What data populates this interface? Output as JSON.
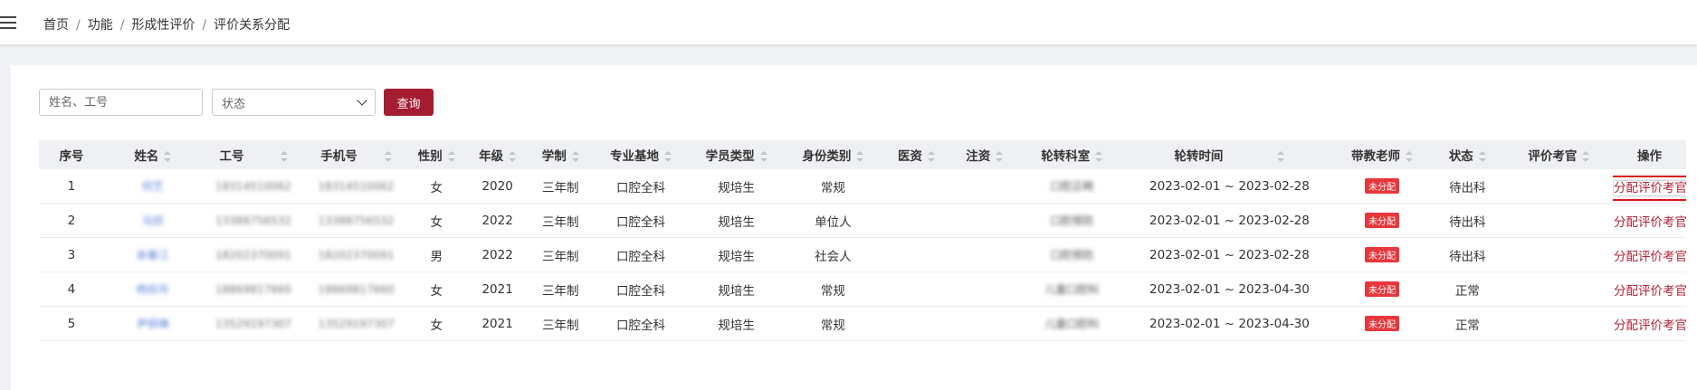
{
  "breadcrumb": [
    "首页",
    "功能",
    "形成性评价",
    "评价关系分配"
  ],
  "search": {
    "placeholder": "姓名、工号",
    "status_placeholder": "状态",
    "query_label": "查询"
  },
  "table": {
    "columns": [
      "序号",
      "姓名",
      "工号",
      "手机号",
      "性别",
      "年级",
      "学制",
      "专业基地",
      "学员类型",
      "身份类别",
      "医资",
      "注资",
      "轮转科室",
      "轮转时间",
      "带教老师",
      "状态",
      "评价考官",
      "操作"
    ],
    "rows": [
      {
        "no": "1",
        "name": "何艺",
        "id": "18314510062",
        "phone": "18314510062",
        "gender": "女",
        "grade": "2020",
        "system": "三年制",
        "base": "口腔全科",
        "type": "规培生",
        "identity": "常规",
        "dept": "口腔正畸",
        "time": "2023-02-01 ~ 2023-02-28",
        "teacher": "未分配",
        "status": "待出科",
        "action": "分配评价考官"
      },
      {
        "no": "2",
        "name": "马欣",
        "id": "13388756532",
        "phone": "13388756532",
        "gender": "女",
        "grade": "2022",
        "system": "三年制",
        "base": "口腔全科",
        "type": "规培生",
        "identity": "单位人",
        "dept": "口腔预防",
        "time": "2023-02-01 ~ 2023-02-28",
        "teacher": "未分配",
        "status": "待出科",
        "action": "分配评价考官"
      },
      {
        "no": "3",
        "name": "余春江",
        "id": "18202370091",
        "phone": "18202370091",
        "gender": "男",
        "grade": "2022",
        "system": "三年制",
        "base": "口腔全科",
        "type": "规培生",
        "identity": "社会人",
        "dept": "口腔预防",
        "time": "2023-02-01 ~ 2023-02-28",
        "teacher": "未分配",
        "status": "待出科",
        "action": "分配评价考官"
      },
      {
        "no": "4",
        "name": "杨玖玲",
        "id": "18869817660",
        "phone": "18869817660",
        "gender": "女",
        "grade": "2021",
        "system": "三年制",
        "base": "口腔全科",
        "type": "规培生",
        "identity": "常规",
        "dept": "儿童口腔科",
        "time": "2023-02-01 ~ 2023-04-30",
        "teacher": "未分配",
        "status": "正常",
        "action": "分配评价考官"
      },
      {
        "no": "5",
        "name": "尹锐琳",
        "id": "13529197307",
        "phone": "13529197307",
        "gender": "女",
        "grade": "2021",
        "system": "三年制",
        "base": "口腔全科",
        "type": "规培生",
        "identity": "常规",
        "dept": "儿童口腔科",
        "time": "2023-02-01 ~ 2023-04-30",
        "teacher": "未分配",
        "status": "正常",
        "action": "分配评价考官"
      }
    ]
  },
  "colors": {
    "accent": "#a51c30",
    "badge": "#e8373c",
    "header_bg": "#eef0f3"
  }
}
